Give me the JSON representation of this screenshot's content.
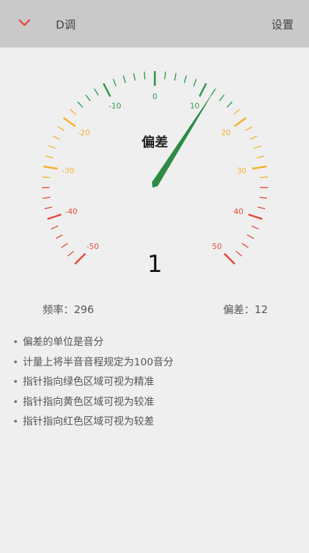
{
  "header": {
    "title": "D调",
    "settings_label": "设置",
    "back_icon": "chevron-down-icon",
    "accent_color": "#e5534b"
  },
  "gauge": {
    "label": "偏差",
    "reading": "1",
    "needle_value": 12,
    "needle_color": "#2e8b45",
    "scale": {
      "min": -50,
      "max": 50,
      "major_step": 10,
      "labels": [
        "-50",
        "-40",
        "-30",
        "-20",
        "-10",
        "0",
        "10",
        "20",
        "30",
        "40",
        "50"
      ]
    },
    "zone_colors": {
      "green": "#2e9a4a",
      "yellow": "#f2b233",
      "red": "#e24b3b"
    }
  },
  "stats": {
    "frequency": "频率：296",
    "deviation": "偏差：12"
  },
  "notes": [
    "偏差的单位是音分",
    "计量上将半音音程规定为100音分",
    "指针指向绿色区域可视为精准",
    "指针指向黄色区域可视为较准",
    "指针指向红色区域可视为较差"
  ]
}
